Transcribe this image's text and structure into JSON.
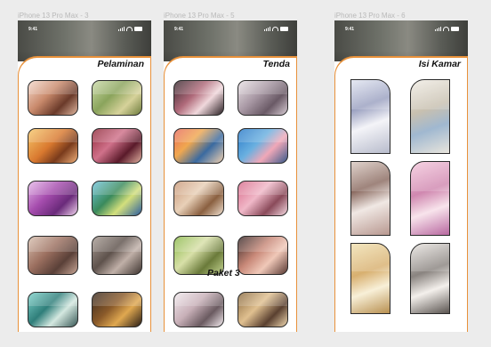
{
  "frames": [
    {
      "label": "iPhone 13 Pro Max - 3",
      "time": "9:41",
      "title": "Pelaminan"
    },
    {
      "label": "iPhone 13 Pro Max - 5",
      "time": "9:41",
      "title": "Tenda"
    },
    {
      "label": "iPhone 13 Pro Max - 6",
      "time": "9:41",
      "title": "Isi Kamar"
    }
  ],
  "overlay": {
    "text": "Paket 3"
  },
  "colors": {
    "accent": "#e8913a",
    "canvas": "#ececec",
    "tile_border": "#2a2a2a"
  },
  "icons": [
    "cellular-signal-icon",
    "wifi-icon",
    "battery-icon"
  ]
}
